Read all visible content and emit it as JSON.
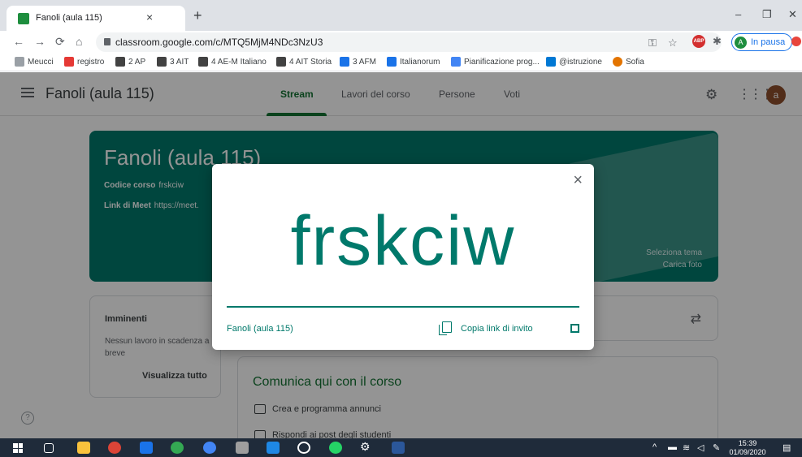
{
  "browser": {
    "tab_title": "Fanoli (aula 115)",
    "tab_close": "×",
    "new_tab": "+",
    "url": "classroom.google.com/c/MTQ5MjM4NDc3NzU3",
    "profile_status": "In pausa",
    "profile_initial": "A",
    "adblock_label": "ABP",
    "window_buttons": [
      "–",
      "❐",
      "✕"
    ]
  },
  "bookmarks": [
    {
      "label": "Meucci",
      "icon": "meucci-icon",
      "color": "#9aa0a6"
    },
    {
      "label": "registro",
      "icon": "registro-icon",
      "color": "#e53935"
    },
    {
      "label": "2 AP",
      "icon": "classroom-icon",
      "color": "#424242"
    },
    {
      "label": "3 AIT",
      "icon": "classroom-icon",
      "color": "#424242"
    },
    {
      "label": "4 AE-M Italiano",
      "icon": "classroom-icon",
      "color": "#424242"
    },
    {
      "label": "4 AIT Storia",
      "icon": "classroom-icon",
      "color": "#424242"
    },
    {
      "label": "3 AFM",
      "icon": "sheet-icon",
      "color": "#1a73e8"
    },
    {
      "label": "Italianorum",
      "icon": "sheet-icon",
      "color": "#1a73e8"
    },
    {
      "label": "Pianificazione prog...",
      "icon": "doc-icon",
      "color": "#4285f4"
    },
    {
      "label": "@istruzione",
      "icon": "outlook-icon",
      "color": "#0078d4"
    },
    {
      "label": "Sofia",
      "icon": "sofia-icon",
      "color": "#e37400"
    }
  ],
  "app": {
    "class_name": "Fanoli (aula 115)",
    "tabs": [
      {
        "label": "Stream",
        "active": true
      },
      {
        "label": "Lavori del corso",
        "active": false
      },
      {
        "label": "Persone",
        "active": false
      },
      {
        "label": "Voti",
        "active": false
      }
    ],
    "user_initial": "a"
  },
  "banner": {
    "title": "Fanoli (aula 115)",
    "code_label": "Codice corso",
    "code_value": "frskciw",
    "meet_label": "Link di Meet",
    "meet_value": "https://meet.",
    "select_theme": "Seleziona tema",
    "upload_photo": "Carica foto"
  },
  "upcoming": {
    "title": "Imminenti",
    "text": "Nessun lavoro in scadenza a breve",
    "link": "Visualizza tutto"
  },
  "stream": {
    "title": "Comunica qui con il corso",
    "rows": [
      "Crea e programma annunci",
      "Rispondi ai post degli studenti"
    ]
  },
  "modal": {
    "code": "frskciw",
    "class_name": "Fanoli (aula 115)",
    "copy_link": "Copia link di invito",
    "close": "×"
  },
  "taskbar": {
    "time": "15:39",
    "date": "01/09/2020"
  }
}
